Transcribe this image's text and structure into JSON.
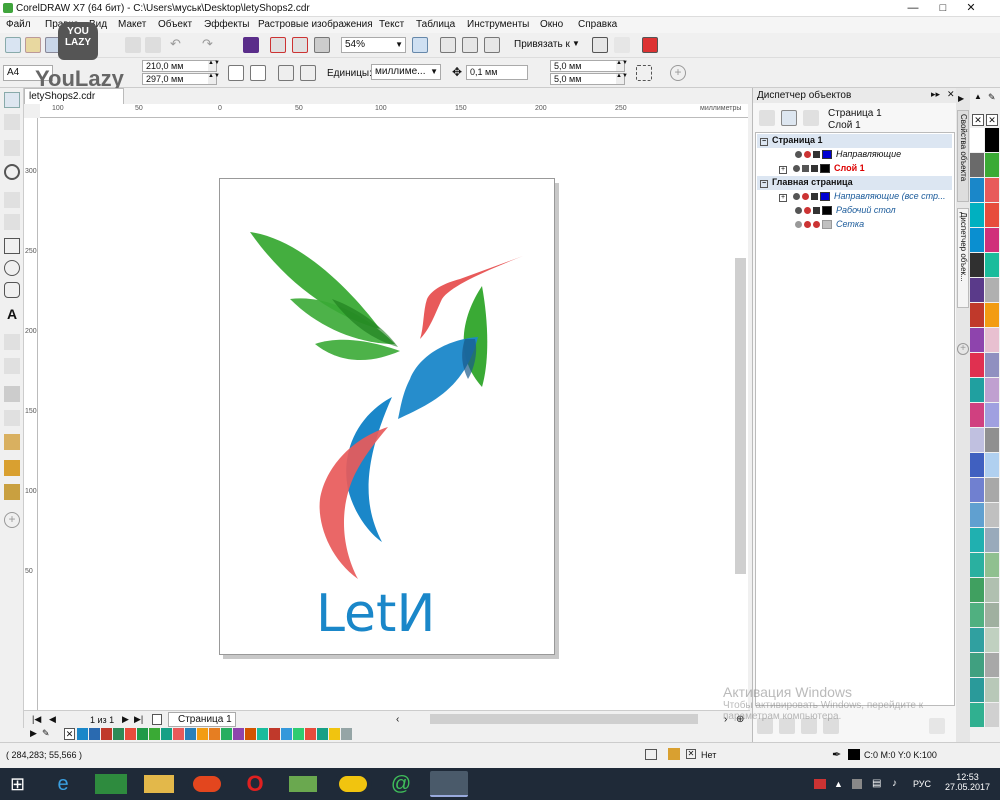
{
  "window": {
    "title": "CorelDRAW X7 (64 бит) - C:\\Users\\муськ\\Desktop\\letyShops2.cdr",
    "controls": [
      "—",
      "□",
      "✕"
    ]
  },
  "menu": [
    "Файл",
    "Правка",
    "Вид",
    "Макет",
    "Объект",
    "Эффекты",
    "Растровые изображения",
    "Текст",
    "Таблица",
    "Инструменты",
    "Окно",
    "Справка"
  ],
  "toolbar": {
    "zoom": "54%",
    "snap_label": "Привязать к"
  },
  "propbar": {
    "page_size": "A4",
    "width": "210,0 мм",
    "height": "297,0 мм",
    "units_label": "Единицы:",
    "units_value": "миллиме...",
    "nudge": "0,1 мм",
    "dup_x": "5,0 мм",
    "dup_y": "5,0 мм"
  },
  "watermark_logo": {
    "badge_line1": "YOU",
    "badge_line2": "LAZY",
    "text": "YouLazy"
  },
  "document": {
    "tab": "letyShops2.cdr",
    "ruler_unit": "миллиметры",
    "ruler_h_ticks": [
      "100",
      "50",
      "0",
      "50",
      "100",
      "150",
      "200",
      "250"
    ],
    "ruler_v_ticks": [
      "300",
      "250",
      "200",
      "150",
      "100",
      "50"
    ]
  },
  "logo_text": "LetИ",
  "page_nav": {
    "counter": "1 из 1",
    "page_tab": "Страница 1"
  },
  "status": {
    "coords": "( 284,283; 55,566 )",
    "fill_none": "Нет",
    "cmyk": "C:0 M:0 Y:0 K:100"
  },
  "object_manager": {
    "title": "Диспетчер объектов",
    "current_page": "Страница 1",
    "current_layer": "Слой 1",
    "tree": [
      {
        "label": "Страница 1",
        "level": 0,
        "header": true
      },
      {
        "label": "Направляющие",
        "level": 1,
        "color": "#0000d0",
        "style": "italic"
      },
      {
        "label": "Слой 1",
        "level": 1,
        "color": "#000000",
        "style": "red"
      },
      {
        "label": "Главная страница",
        "level": 0,
        "header": true
      },
      {
        "label": "Направляющие (все стр...",
        "level": 1,
        "color": "#0000d0",
        "style": "italic"
      },
      {
        "label": "Рабочий стол",
        "level": 1,
        "color": "#000000",
        "style": "italic"
      },
      {
        "label": "Сетка",
        "level": 1,
        "color": "#c0c0c0",
        "style": "italic"
      }
    ]
  },
  "side_tabs": [
    "Свойства объекта",
    "Диспетчер объек..."
  ],
  "activation": {
    "line1": "Активация Windows",
    "line2": "Чтобы активировать Windows, перейдите к",
    "line3": "параметрам компьютера."
  },
  "clock": {
    "time": "12:53",
    "date": "27.05.2017"
  },
  "language": "РУС",
  "colors": {
    "green": "#3aaa35",
    "blue": "#1a87c9",
    "red": "#e85a5a"
  }
}
